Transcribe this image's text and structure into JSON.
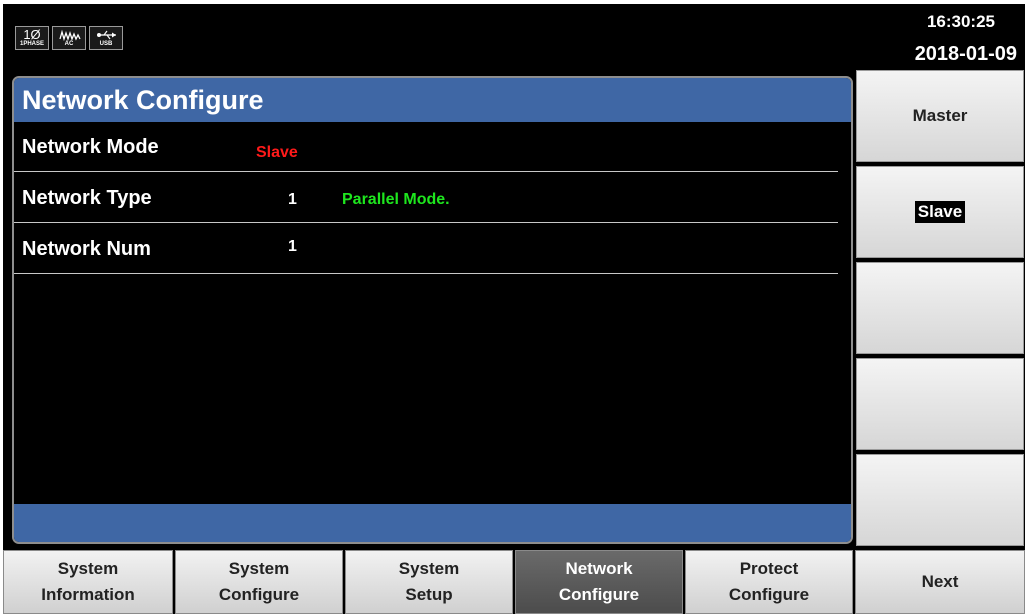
{
  "status": {
    "phase_icon": {
      "symbol": "1Ø",
      "caption": "1PHASE"
    },
    "ac_icon": {
      "caption": "AC"
    },
    "usb_icon": {
      "caption": "USB"
    },
    "time": "16:30:25",
    "date": "2018-01-09"
  },
  "panel": {
    "title": "Network Configure",
    "rows": [
      {
        "label": "Network Mode",
        "value": "Slave",
        "value_color": "#ff1a1a"
      },
      {
        "label": "Network Type",
        "value": "1",
        "extra": "Parallel Mode.",
        "extra_color": "#1ee61e"
      },
      {
        "label": "Network Num",
        "value": "1"
      }
    ]
  },
  "softkeys": [
    {
      "label": "Master"
    },
    {
      "label": "Slave",
      "highlighted": true
    },
    {
      "label": ""
    },
    {
      "label": ""
    },
    {
      "label": ""
    }
  ],
  "tabs": [
    {
      "line1": "System",
      "line2": "Information"
    },
    {
      "line1": "System",
      "line2": "Configure"
    },
    {
      "line1": "System",
      "line2": "Setup"
    },
    {
      "line1": "Network",
      "line2": "Configure",
      "active": true
    },
    {
      "line1": "Protect",
      "line2": "Configure"
    },
    {
      "line1": "Next",
      "line2": ""
    }
  ],
  "colors": {
    "header_blue": "#3f67a5",
    "active_tab": "#555555"
  }
}
